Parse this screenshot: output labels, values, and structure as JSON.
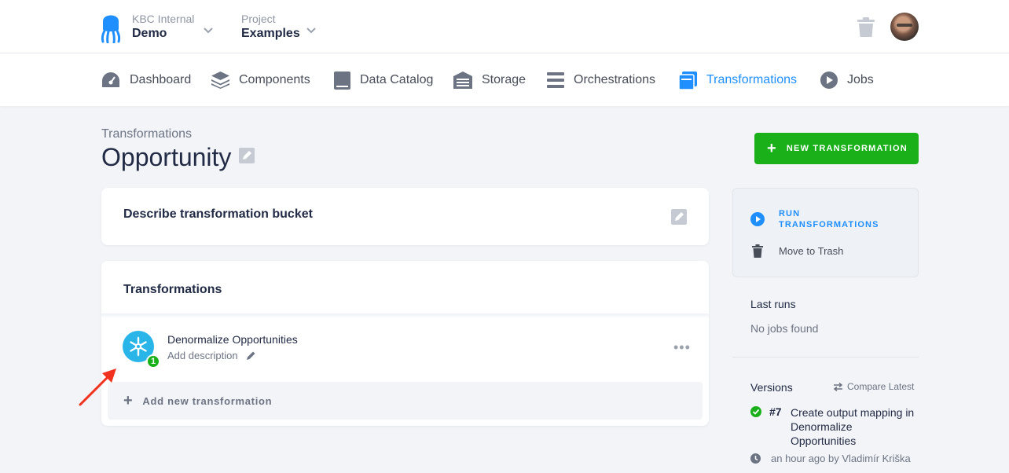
{
  "header": {
    "org_label": "KBC Internal",
    "org_value": "Demo",
    "project_label": "Project",
    "project_value": "Examples"
  },
  "nav": {
    "items": [
      {
        "label": "Dashboard",
        "icon": "gauge-icon"
      },
      {
        "label": "Components",
        "icon": "layers-icon"
      },
      {
        "label": "Data Catalog",
        "icon": "book-icon"
      },
      {
        "label": "Storage",
        "icon": "warehouse-icon"
      },
      {
        "label": "Orchestrations",
        "icon": "bars-icon"
      },
      {
        "label": "Transformations",
        "icon": "window-icon",
        "active": true
      },
      {
        "label": "Jobs",
        "icon": "play-circle-icon"
      }
    ]
  },
  "page": {
    "breadcrumb": "Transformations",
    "title": "Opportunity",
    "new_button": "NEW TRANSFORMATION"
  },
  "description_card": {
    "text": "Describe transformation bucket"
  },
  "transformations_card": {
    "heading": "Transformations",
    "rows": [
      {
        "name": "Denormalize Opportunities",
        "description": "Add description",
        "badge": "1",
        "icon": "snowflake-icon"
      }
    ],
    "add_label": "Add new transformation"
  },
  "sidebar": {
    "run_label": "RUN TRANSFORMATIONS",
    "trash_label": "Move to Trash",
    "last_runs_heading": "Last runs",
    "last_runs_value": "No jobs found",
    "versions_heading": "Versions",
    "compare_label": "Compare Latest",
    "version": {
      "number": "#7",
      "message": "Create output mapping in Denormalize Opportunities",
      "meta": "an hour ago by Vladimír Kriška"
    }
  },
  "colors": {
    "accent": "#1f8fff",
    "success": "#1ab01a",
    "snowflake": "#29b5e8"
  }
}
